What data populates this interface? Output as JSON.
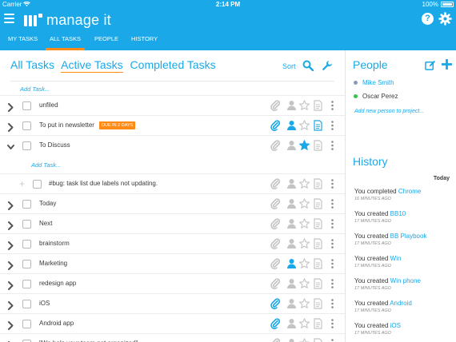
{
  "status_bar": {
    "carrier": "Carrier",
    "time": "2:14 PM",
    "battery": "100%"
  },
  "app": {
    "name": "manage it"
  },
  "nav": {
    "tabs": [
      "MY TASKS",
      "ALL TASKS",
      "PEOPLE",
      "HISTORY"
    ],
    "active": "ALL TASKS"
  },
  "view_tabs": [
    "All Tasks",
    "Active Tasks",
    "Completed Tasks"
  ],
  "active_view": "Active Tasks",
  "toolbar": {
    "sort_label": "Sort"
  },
  "add_task_label": "Add Task...",
  "tasks": [
    {
      "title": "unfiled",
      "expanded": false,
      "due": ""
    },
    {
      "title": "To put in newsletter",
      "expanded": false,
      "due": "DUE IN 2 DAYS"
    },
    {
      "title": "To Discuss",
      "expanded": true,
      "due": ""
    },
    {
      "title": "#bug: task list due labels not updating.",
      "subtask": true
    },
    {
      "title": "Today",
      "expanded": false
    },
    {
      "title": "Next",
      "expanded": false
    },
    {
      "title": "brainstorm",
      "expanded": false
    },
    {
      "title": "Marketing",
      "expanded": false
    },
    {
      "title": "redesign app",
      "expanded": false
    },
    {
      "title": "iOS",
      "expanded": false
    },
    {
      "title": "Android app",
      "expanded": false
    },
    {
      "title": "\"We help your team get organized\"",
      "expanded": false
    }
  ],
  "people": {
    "title": "People",
    "list": [
      {
        "name": "Mike Smith",
        "status_color": "#8a9ab5"
      },
      {
        "name": "Oscar Perez",
        "status_color": "#35c24a"
      }
    ],
    "add_label": "Add new person to project..."
  },
  "history": {
    "title": "History",
    "day_label": "Today",
    "entries": [
      {
        "text": "You completed",
        "target": "Chrome",
        "ago": "16 MINUTES AGO"
      },
      {
        "text": "You created",
        "target": "BB10",
        "ago": "17 MINUTES AGO"
      },
      {
        "text": "You created",
        "target": "BB Playbook",
        "ago": "17 MINUTES AGO"
      },
      {
        "text": "You created",
        "target": "Win",
        "ago": "17 MINUTES AGO"
      },
      {
        "text": "You created",
        "target": "Win phone",
        "ago": "17 MINUTES AGO"
      },
      {
        "text": "You created",
        "target": "Android",
        "ago": "17 MINUTES AGO"
      },
      {
        "text": "You created",
        "target": "iOS",
        "ago": "17 MINUTES AGO"
      }
    ]
  },
  "colors": {
    "brand": "#1aa8e8",
    "accent": "#ff8a16",
    "text": "#3a3a3a",
    "icon_idle": "#c4c4c4"
  }
}
